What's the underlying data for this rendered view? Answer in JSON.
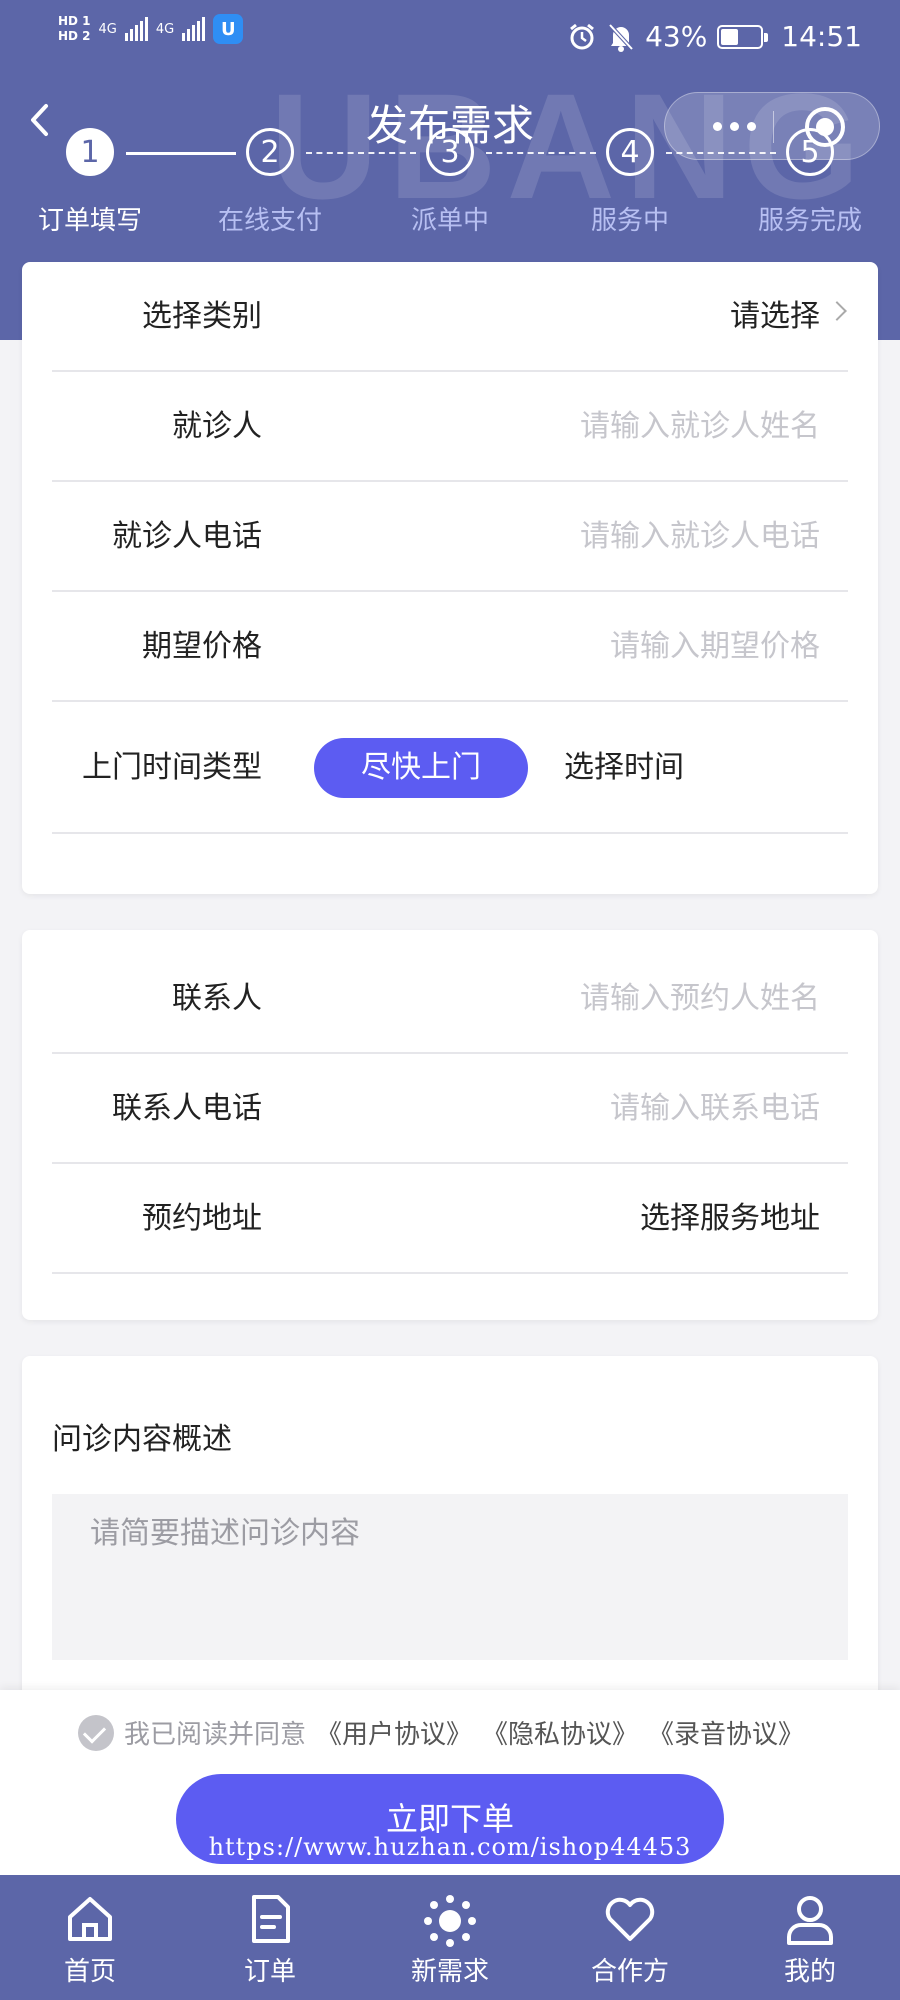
{
  "status_bar": {
    "hd1": "HD 1",
    "hd2": "HD 2",
    "net1": "4G",
    "net2": "4G",
    "battery_text": "43%",
    "battery_level": 0.43,
    "time": "14:51"
  },
  "header": {
    "title": "发布需求",
    "watermark": "UBANG"
  },
  "steps": [
    {
      "number": "1",
      "label": "订单填写",
      "active": true
    },
    {
      "number": "2",
      "label": "在线支付",
      "active": false
    },
    {
      "number": "3",
      "label": "派单中",
      "active": false
    },
    {
      "number": "4",
      "label": "服务中",
      "active": false
    },
    {
      "number": "5",
      "label": "服务完成",
      "active": false
    }
  ],
  "form1": {
    "category": {
      "label": "选择类别",
      "value": "请选择"
    },
    "patient": {
      "label": "就诊人",
      "placeholder": "请输入就诊人姓名"
    },
    "patient_phone": {
      "label": "就诊人电话",
      "placeholder": "请输入就诊人电话"
    },
    "price": {
      "label": "期望价格",
      "placeholder": "请输入期望价格"
    },
    "visit_time": {
      "label": "上门时间类型",
      "option_selected": "尽快上门",
      "option_other": "选择时间"
    }
  },
  "form2": {
    "contact": {
      "label": "联系人",
      "placeholder": "请输入预约人姓名"
    },
    "contact_phone": {
      "label": "联系人电话",
      "placeholder": "请输入联系电话"
    },
    "address": {
      "label": "预约地址",
      "value": "选择服务地址"
    }
  },
  "description": {
    "title": "问诊内容概述",
    "placeholder": "请简要描述问诊内容"
  },
  "agreement": {
    "prefix": "我已阅读并同意",
    "user": "《用户协议》",
    "privacy": "《隐私协议》",
    "recording": "《录音协议》"
  },
  "submit_label": "立即下单",
  "watermark_url": "https://www.huzhan.com/ishop44453",
  "tabs": [
    {
      "label": "首页",
      "icon": "home-icon"
    },
    {
      "label": "订单",
      "icon": "document-icon"
    },
    {
      "label": "新需求",
      "icon": "sun-icon"
    },
    {
      "label": "合作方",
      "icon": "heart-icon"
    },
    {
      "label": "我的",
      "icon": "user-icon"
    }
  ]
}
